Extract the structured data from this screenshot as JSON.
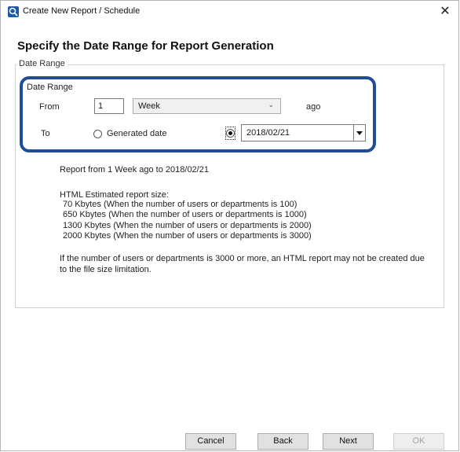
{
  "window": {
    "title": "Create New Report / Schedule",
    "close_glyph": "✕"
  },
  "page": {
    "heading": "Specify the Date Range for Report Generation"
  },
  "group": {
    "legend": "Date Range",
    "inner_label": "Date Range"
  },
  "from": {
    "label": "From",
    "value": "1",
    "unit_selected": "Week",
    "suffix": "ago"
  },
  "to": {
    "label": "To",
    "option_generated": "Generated date",
    "option_generated_checked": false,
    "option_date_checked": true,
    "date_value": "2018/02/21"
  },
  "info": {
    "summary": "Report from 1 Week ago to 2018/02/21",
    "size_heading": "HTML Estimated report size:",
    "sizes": [
      "70 Kbytes (When the number of users or departments is 100)",
      "650 Kbytes (When the number of users or departments is 1000)",
      "1300 Kbytes (When the number of users or departments is 2000)",
      "2000 Kbytes (When the number of users or departments is 3000)"
    ],
    "warning_line1": "If the number of users or departments is 3000 or more, an HTML report may not be created due",
    "warning_line2": "to the file size limitation."
  },
  "buttons": {
    "cancel": "Cancel",
    "back": "Back",
    "next": "Next",
    "ok": "OK"
  },
  "colors": {
    "highlight": "#1f4e96",
    "app_icon": "#1e5aa8"
  },
  "icons": {
    "app": "report-app-icon",
    "close": "close-icon",
    "dropdown": "chevron-down-icon"
  }
}
